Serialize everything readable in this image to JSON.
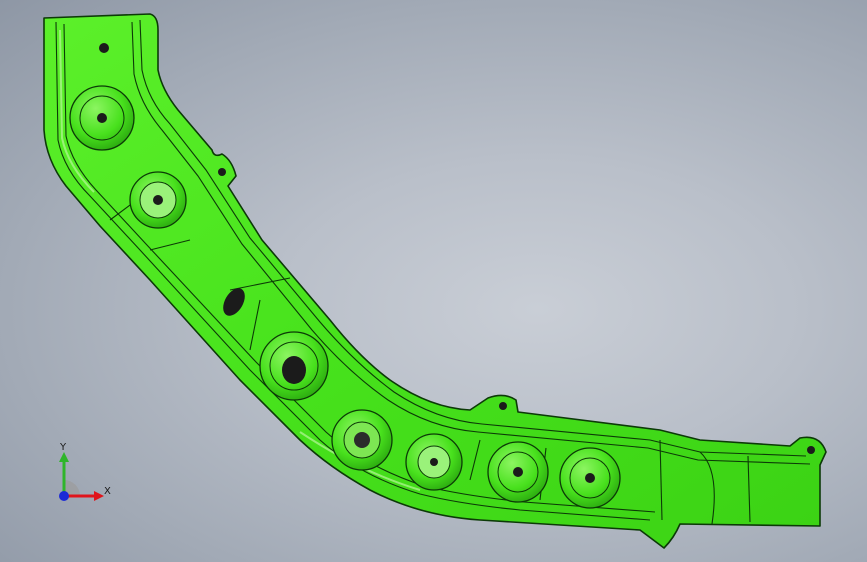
{
  "viewport": {
    "background_top": "#8e97a5",
    "background_center": "#c9ced6"
  },
  "part": {
    "body_color": "#47e21c",
    "edge_color": "#0c3a07",
    "shade_color": "#2fae12",
    "highlight_color": "#b6f59a",
    "hole_color": "#1b1b1b"
  },
  "triad": {
    "x_label": "X",
    "y_label": "Y",
    "x_color": "#e0141b",
    "y_color": "#2fb52a",
    "z_color": "#1c2bd6"
  }
}
